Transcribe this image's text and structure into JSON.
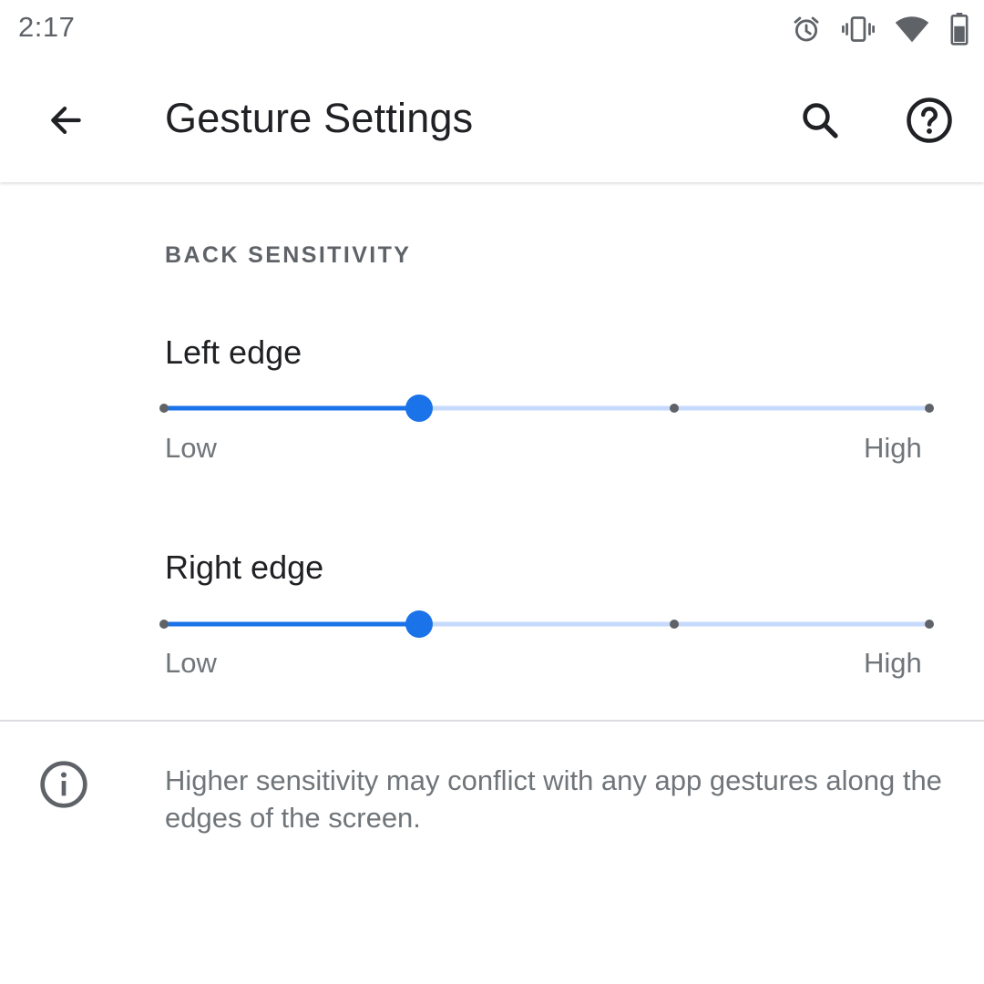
{
  "status_bar": {
    "time": "2:17",
    "icons": [
      "alarm-icon",
      "vibrate-icon",
      "wifi-icon",
      "battery-icon"
    ]
  },
  "app_bar": {
    "title": "Gesture Settings",
    "icons": [
      "back-arrow-icon",
      "search-icon",
      "help-icon"
    ]
  },
  "section": {
    "header": "BACK SENSITIVITY"
  },
  "sliders": [
    {
      "title": "Left edge",
      "min_label": "Low",
      "max_label": "High",
      "steps": 4,
      "value_index": 1
    },
    {
      "title": "Right edge",
      "min_label": "Low",
      "max_label": "High",
      "steps": 4,
      "value_index": 1
    }
  ],
  "footer": {
    "icon": "info-icon",
    "text": "Higher sensitivity may conflict with any app gestures along the edges of the screen."
  },
  "colors": {
    "accent": "#1a73e8",
    "track_inactive": "#c6dafc",
    "tick": "#5f6368"
  }
}
